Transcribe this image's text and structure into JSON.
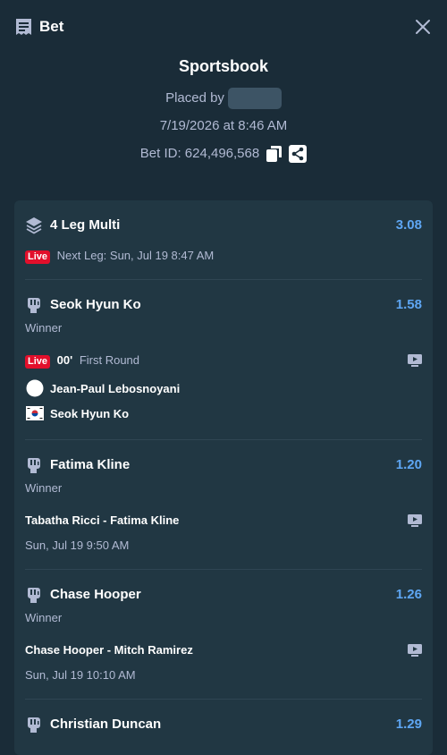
{
  "header": {
    "title": "Bet",
    "close_icon": "close-icon",
    "bet_icon": "receipt-icon"
  },
  "summary": {
    "book": "Sportsbook",
    "placed_by": "Placed by",
    "date": "7/19/2026 at 8:46 AM",
    "bet_id": "Bet ID: 624,496,568"
  },
  "multi": {
    "title": "4 Leg Multi",
    "odds": "3.08",
    "live_badge": "Live",
    "next_leg": "Next Leg: Sun, Jul 19 8:47 AM"
  },
  "legs": [
    {
      "fighter": "Seok Hyun Ko",
      "odds": "1.58",
      "market": "Winner",
      "live_badge": "Live",
      "time": "00'",
      "round": "First Round",
      "competitor1": "Jean-Paul Lebosnoyani",
      "competitor2": "Seok Hyun Ko"
    },
    {
      "fighter": "Fatima Kline",
      "odds": "1.20",
      "market": "Winner",
      "event": "Tabatha Ricci - Fatima Kline",
      "datetime": "Sun, Jul 19  9:50 AM"
    },
    {
      "fighter": "Chase Hooper",
      "odds": "1.26",
      "market": "Winner",
      "event": "Chase Hooper - Mitch Ramirez",
      "datetime": "Sun, Jul 19  10:10 AM"
    },
    {
      "fighter": "Christian Duncan",
      "odds": "1.29"
    }
  ],
  "colors": {
    "background": "#1a2c38",
    "card": "#213743",
    "odds": "#5ea6f3",
    "live": "#e20f2b"
  }
}
